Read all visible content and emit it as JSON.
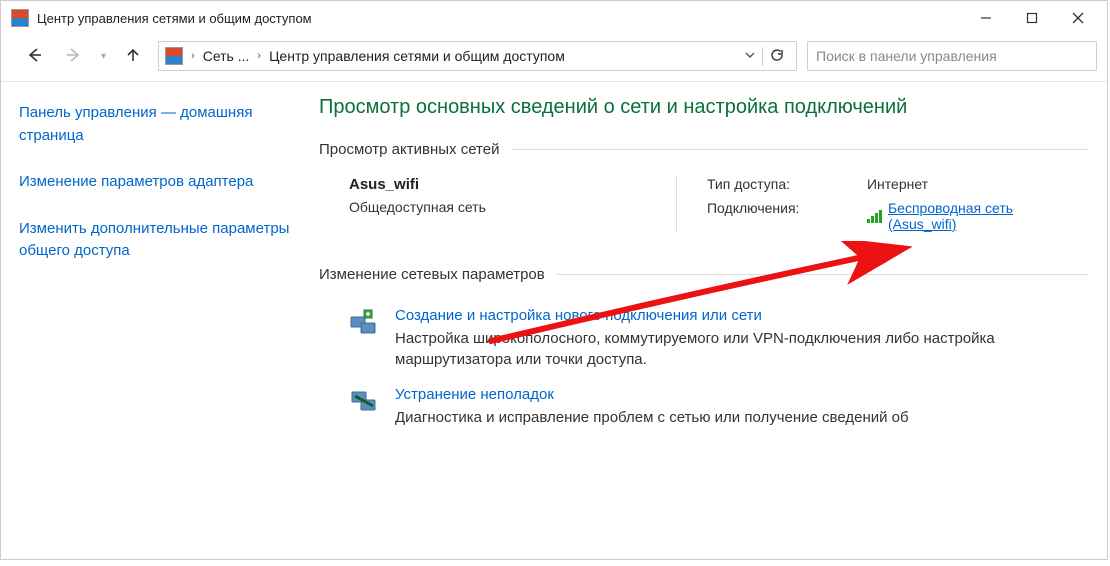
{
  "titlebar": {
    "title": "Центр управления сетями и общим доступом"
  },
  "breadcrumb": {
    "crumb1": "Сеть ...",
    "crumb2": "Центр управления сетями и общим доступом"
  },
  "search": {
    "placeholder": "Поиск в панели управления"
  },
  "sidebar": {
    "home": "Панель управления — домашняя страница",
    "adapter": "Изменение параметров адаптера",
    "sharing": "Изменить дополнительные параметры общего доступа"
  },
  "main": {
    "heading": "Просмотр основных сведений о сети и настройка подключений",
    "section_active": "Просмотр активных сетей",
    "section_change": "Изменение сетевых параметров"
  },
  "network": {
    "ssid": "Asus_wifi",
    "type": "Общедоступная сеть",
    "access_label": "Тип доступа:",
    "access_value": "Интернет",
    "conn_label": "Подключения:",
    "conn_link": "Беспроводная сеть (Asus_wifi)"
  },
  "task1": {
    "title": "Создание и настройка нового подключения или сети",
    "desc": "Настройка широкополосного, коммутируемого или VPN-подключения либо настройка маршрутизатора или точки доступа."
  },
  "task2": {
    "title": "Устранение неполадок",
    "desc": "Диагностика и исправление проблем с сетью или получение сведений об"
  }
}
